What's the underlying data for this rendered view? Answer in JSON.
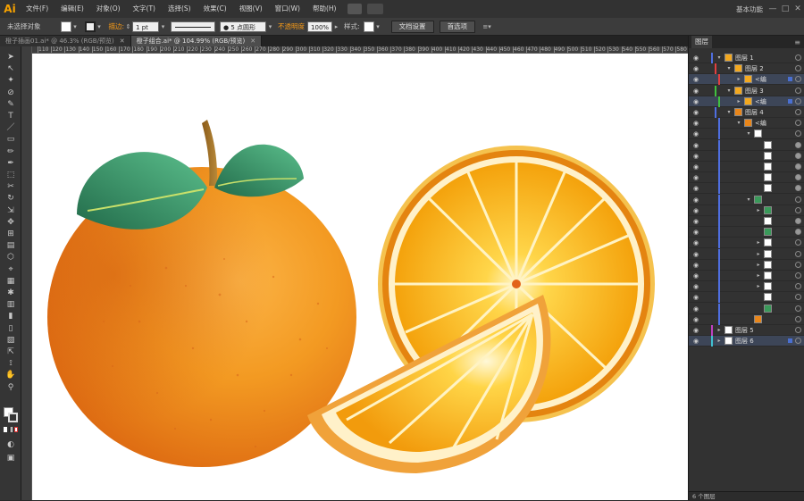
{
  "app": {
    "logo": "Ai",
    "workspace": "基本功能"
  },
  "menu": [
    "文件(F)",
    "编辑(E)",
    "对象(O)",
    "文字(T)",
    "选择(S)",
    "效果(C)",
    "视图(V)",
    "窗口(W)",
    "帮助(H)"
  ],
  "window_buttons": [
    "—",
    "□",
    "✕"
  ],
  "control": {
    "selection_status": "未选择对象",
    "stroke_label": "描边:",
    "stroke_weight": "1 pt",
    "stroke_profile": "等比",
    "brush": "5 点圆形",
    "opacity_label": "不透明度",
    "opacity_value": "100%",
    "style_label": "样式:",
    "doc_setup": "文档设置",
    "preferences": "首选项"
  },
  "tabs": [
    {
      "label": "橙子插画01.ai* @ 46.3% (RGB/预览)",
      "close": "✕",
      "active": false
    },
    {
      "label": "橙子组合.ai* @ 104.99% (RGB/预览)",
      "close": "✕",
      "active": true
    }
  ],
  "ruler_ticks": [
    "110",
    "120",
    "130",
    "140",
    "150",
    "160",
    "170",
    "180",
    "190",
    "200",
    "210",
    "220",
    "230",
    "240",
    "250",
    "260",
    "270",
    "280",
    "290",
    "300",
    "310",
    "320",
    "330",
    "340",
    "350",
    "360",
    "370",
    "380",
    "390",
    "400",
    "410",
    "420",
    "430",
    "440",
    "450",
    "460",
    "470",
    "480",
    "490",
    "500",
    "510",
    "520",
    "530",
    "540",
    "550",
    "560",
    "570",
    "580"
  ],
  "tools": [
    "➤",
    "↖",
    "✦",
    "⊘",
    "✎",
    "T",
    "／",
    "▭",
    "✏",
    "✒",
    "⬚",
    "✂",
    "↻",
    "⇲",
    "✥",
    "⊞",
    "▤",
    "⬡",
    "⌖",
    "▦",
    "✱",
    "▥",
    "▮",
    "▯",
    "▧",
    "⇱",
    "⟟",
    "✋",
    "⚲"
  ],
  "layers_panel": {
    "tab": "图层",
    "menu_icon": "≡",
    "footer": "6 个图层",
    "rows": [
      {
        "indent": 0,
        "expand": "▾",
        "name": "图层 1",
        "color": "#4f6fe0",
        "thumb": "#f3a81f",
        "sel": false,
        "target_filled": false
      },
      {
        "indent": 1,
        "expand": "▾",
        "name": "图层 2",
        "color": "#e04040",
        "thumb": "#f3a81f",
        "sel": false,
        "target_filled": false
      },
      {
        "indent": 2,
        "expand": "▸",
        "name": "<编",
        "color": "#e04040",
        "thumb": "#f3a81f",
        "sel": true,
        "target_filled": false
      },
      {
        "indent": 1,
        "expand": "▾",
        "name": "图层 3",
        "color": "#40c040",
        "thumb": "#f3a81f",
        "sel": false,
        "target_filled": false
      },
      {
        "indent": 2,
        "expand": "▸",
        "name": "<编",
        "color": "#40c040",
        "thumb": "#f3a81f",
        "sel": true,
        "target_filled": false
      },
      {
        "indent": 1,
        "expand": "▾",
        "name": "图层 4",
        "color": "#4f6fe0",
        "thumb": "#e9861a",
        "sel": false,
        "target_filled": false
      },
      {
        "indent": 2,
        "expand": "▾",
        "name": "<编",
        "color": "#4f6fe0",
        "thumb": "#e9861a",
        "sel": false,
        "target_filled": false
      },
      {
        "indent": 3,
        "expand": "▾",
        "name": "",
        "color": "#4f6fe0",
        "thumb": "#ffffff",
        "sel": false,
        "target_filled": false
      },
      {
        "indent": 4,
        "expand": "",
        "name": "",
        "color": "#4f6fe0",
        "thumb": "#ffffff",
        "sel": false,
        "target_filled": true
      },
      {
        "indent": 4,
        "expand": "",
        "name": "",
        "color": "#4f6fe0",
        "thumb": "#ffffff",
        "sel": false,
        "target_filled": true
      },
      {
        "indent": 4,
        "expand": "",
        "name": "",
        "color": "#4f6fe0",
        "thumb": "#ffffff",
        "sel": false,
        "target_filled": true
      },
      {
        "indent": 4,
        "expand": "",
        "name": "",
        "color": "#4f6fe0",
        "thumb": "#ffffff",
        "sel": false,
        "target_filled": true
      },
      {
        "indent": 4,
        "expand": "",
        "name": "",
        "color": "#4f6fe0",
        "thumb": "#ffffff",
        "sel": false,
        "target_filled": true
      },
      {
        "indent": 3,
        "expand": "▾",
        "name": "",
        "color": "#4f6fe0",
        "thumb": "#3a9a5a",
        "sel": false,
        "target_filled": false
      },
      {
        "indent": 4,
        "expand": "▸",
        "name": "",
        "color": "#4f6fe0",
        "thumb": "#3a9a5a",
        "sel": false,
        "target_filled": false
      },
      {
        "indent": 4,
        "expand": "",
        "name": "",
        "color": "#4f6fe0",
        "thumb": "#ffffff",
        "sel": false,
        "target_filled": true
      },
      {
        "indent": 4,
        "expand": "",
        "name": "",
        "color": "#4f6fe0",
        "thumb": "#3a9a5a",
        "sel": false,
        "target_filled": true
      },
      {
        "indent": 4,
        "expand": "▸",
        "name": "",
        "color": "#4f6fe0",
        "thumb": "#ffffff",
        "sel": false,
        "target_filled": false
      },
      {
        "indent": 4,
        "expand": "▸",
        "name": "",
        "color": "#4f6fe0",
        "thumb": "#ffffff",
        "sel": false,
        "target_filled": false
      },
      {
        "indent": 4,
        "expand": "▸",
        "name": "",
        "color": "#4f6fe0",
        "thumb": "#ffffff",
        "sel": false,
        "target_filled": false
      },
      {
        "indent": 4,
        "expand": "▸",
        "name": "",
        "color": "#4f6fe0",
        "thumb": "#ffffff",
        "sel": false,
        "target_filled": false
      },
      {
        "indent": 4,
        "expand": "▸",
        "name": "",
        "color": "#4f6fe0",
        "thumb": "#ffffff",
        "sel": false,
        "target_filled": false
      },
      {
        "indent": 4,
        "expand": "",
        "name": "",
        "color": "#4f6fe0",
        "thumb": "#ffffff",
        "sel": false,
        "target_filled": false
      },
      {
        "indent": 4,
        "expand": "",
        "name": "",
        "color": "#4f6fe0",
        "thumb": "#3a9a5a",
        "sel": false,
        "target_filled": false
      },
      {
        "indent": 3,
        "expand": "",
        "name": "",
        "color": "#4f6fe0",
        "thumb": "#e9861a",
        "sel": false,
        "target_filled": false
      },
      {
        "indent": 0,
        "expand": "▸",
        "name": "图层 5",
        "color": "#c040c0",
        "thumb": "#ffffff",
        "sel": false,
        "target_filled": false
      },
      {
        "indent": 0,
        "expand": "▸",
        "name": "图层 6",
        "color": "#40c0d0",
        "thumb": "#ffffff",
        "sel": true,
        "target_filled": false
      }
    ]
  },
  "colors": {
    "accent": "#f79a16",
    "panel": "#323232",
    "canvas": "#ffffff"
  }
}
